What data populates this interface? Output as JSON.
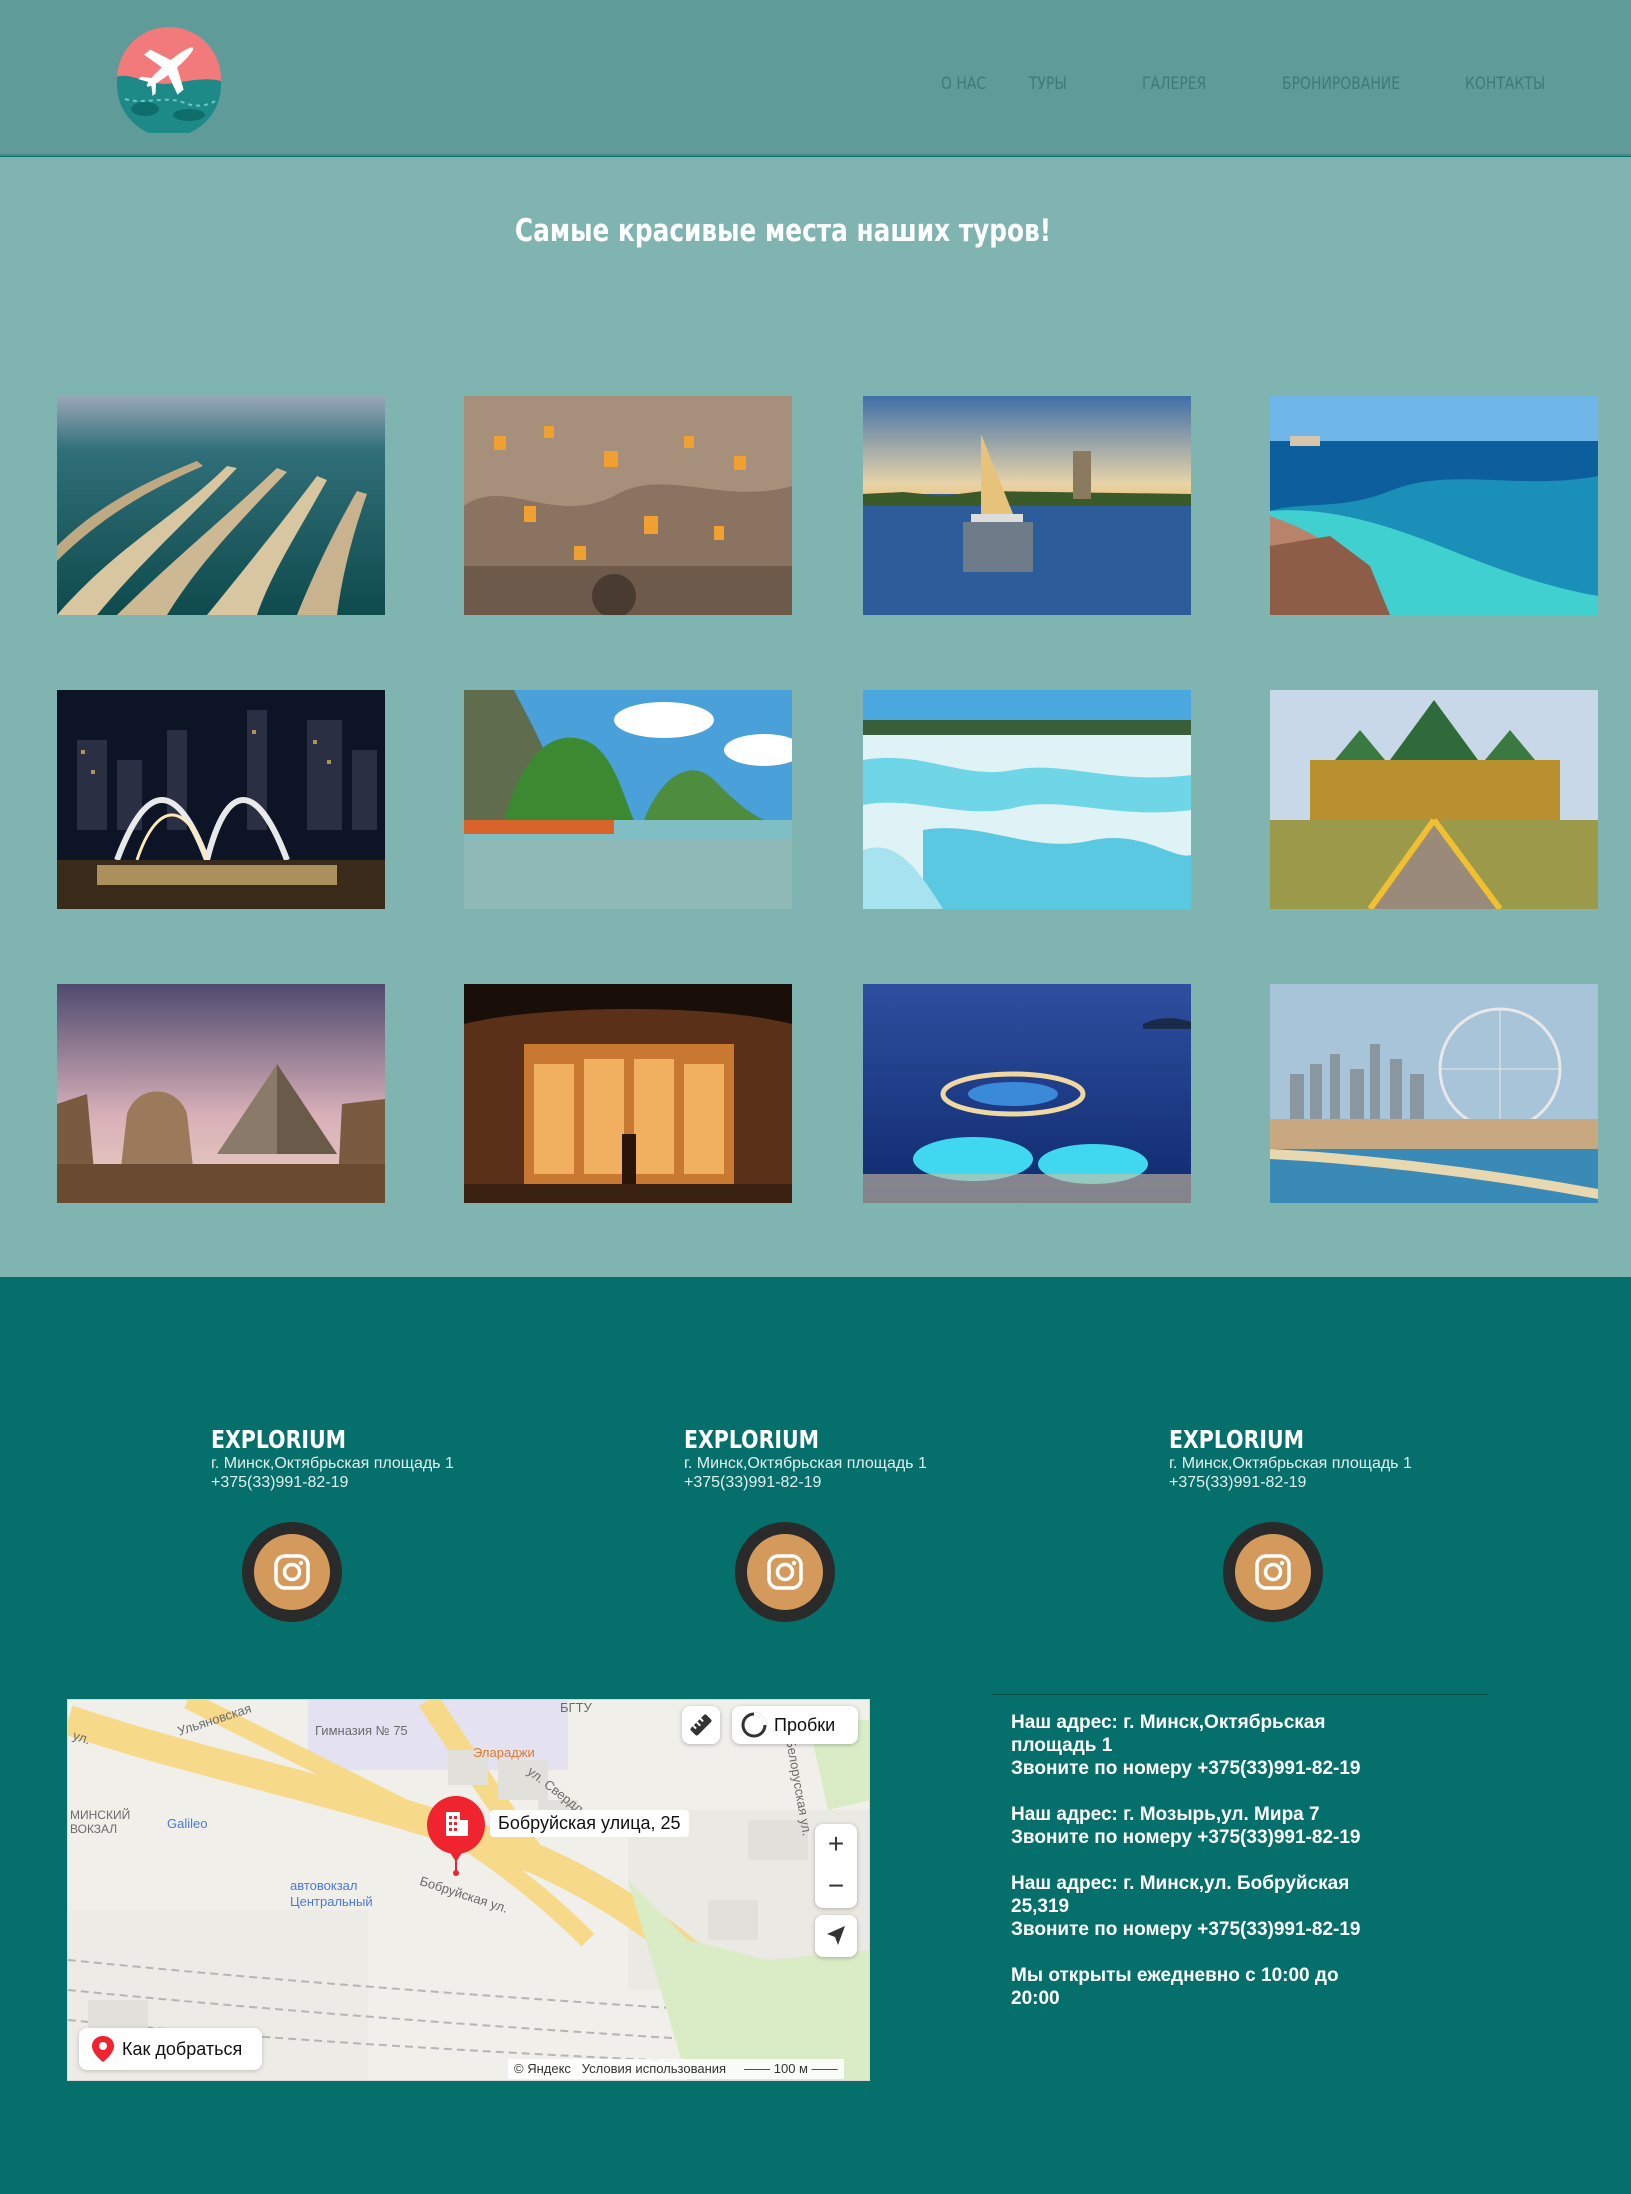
{
  "nav": {
    "about": "О НАС",
    "tours": "ТУРЫ",
    "gallery": "ГАЛЕРЕЯ",
    "booking": "БРОНИРОВАНИЕ",
    "contacts": "КОНТАКТЫ"
  },
  "gallery": {
    "title": "Самые красивые места наших туров!"
  },
  "footer": {
    "brands": [
      {
        "name": "EXPLORIUM",
        "address": "г. Минск,Октябрьская площадь 1",
        "phone": "+375(33)991-82-19"
      },
      {
        "name": "EXPLORIUM",
        "address": "г. Минск,Октябрьская площадь 1",
        "phone": "+375(33)991-82-19"
      },
      {
        "name": "EXPLORIUM",
        "address": "г. Минск,Октябрьская площадь 1",
        "phone": "+375(33)991-82-19"
      }
    ],
    "map": {
      "pin_label": "Бобруйская улица, 25",
      "traffic_button": "Пробки",
      "route_button": "Как добраться",
      "zoom_in": "+",
      "zoom_out": "−",
      "copyright": "© Яндекс",
      "terms": "Условия использования",
      "scale": "100 м",
      "labels": {
        "gymnasium": "Гимназия № 75",
        "elardzhi": "Элараджи",
        "bgtu": "БГТУ",
        "minsk_station": "МИНСКИЙ ВОКЗАЛ",
        "galileo": "Galileo",
        "bus_station": "автовокзал Центральный",
        "bobruiskaya": "Бобруйская ул.",
        "ulyanovskaya": "Ульяновская",
        "sverdlova": "ул. Свердлова",
        "belorusskaya": "Белорусская ул.",
        "ul": "ул."
      }
    },
    "contacts": [
      {
        "line1": "Наш адрес: г. Минск,Октябрьская площадь 1",
        "line2": "Звоните по номеру +375(33)991-82-19"
      },
      {
        "line1": "Наш адрес: г. Мозырь,ул. Мира 7",
        "line2": "Звоните по номеру +375(33)991-82-19"
      },
      {
        "line1": "Наш адрес: г. Минск,ул. Бобруйская 25,319",
        "line2": "Звоните по номеру +375(33)991-82-19"
      },
      {
        "line1": "Мы открыты ежедневно с 10:00 до 20:00",
        "line2": ""
      }
    ]
  }
}
